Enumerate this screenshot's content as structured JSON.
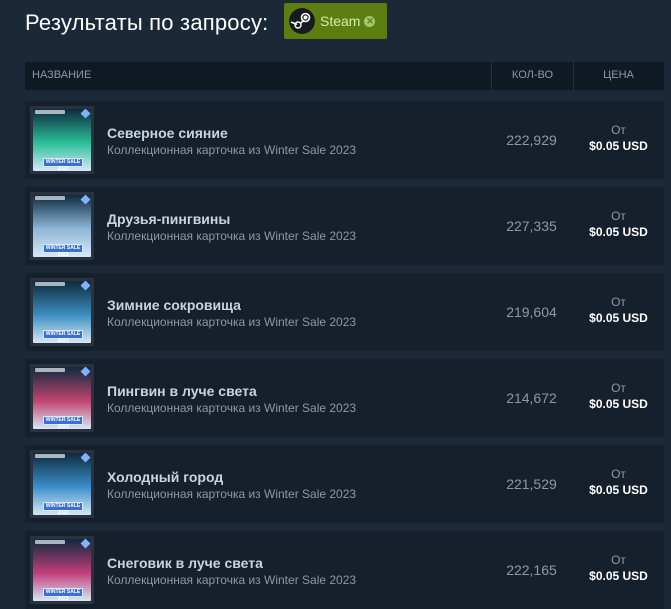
{
  "page": {
    "title": "Результаты по запросу:"
  },
  "filter": {
    "label": "Steam",
    "icon": "steam-logo-icon",
    "remove_icon": "close-icon",
    "color": "#5c7e10"
  },
  "table": {
    "columns": {
      "name": "НАЗВАНИЕ",
      "quantity": "КОЛ-ВО",
      "price": "ЦЕНА"
    },
    "rows": [
      {
        "name": "Северное сияние",
        "subtitle": "Коллекционная карточка из Winter Sale 2023",
        "quantity": "222,929",
        "price_from": "От",
        "price": "$0.05 USD",
        "art_color": "#2bbf9a"
      },
      {
        "name": "Друзья-пингвины",
        "subtitle": "Коллекционная карточка из Winter Sale 2023",
        "quantity": "227,335",
        "price_from": "От",
        "price": "$0.05 USD",
        "art_color": "#8fb7d8"
      },
      {
        "name": "Зимние сокровища",
        "subtitle": "Коллекционная карточка из Winter Sale 2023",
        "quantity": "219,604",
        "price_from": "От",
        "price": "$0.05 USD",
        "art_color": "#3c8fbf"
      },
      {
        "name": "Пингвин в луче света",
        "subtitle": "Коллекционная карточка из Winter Sale 2023",
        "quantity": "214,672",
        "price_from": "От",
        "price": "$0.05 USD",
        "art_color": "#c04470"
      },
      {
        "name": "Холодный город",
        "subtitle": "Коллекционная карточка из Winter Sale 2023",
        "quantity": "221,529",
        "price_from": "От",
        "price": "$0.05 USD",
        "art_color": "#3b8fc9"
      },
      {
        "name": "Снеговик в луче света",
        "subtitle": "Коллекционная карточка из Winter Sale 2023",
        "quantity": "222,165",
        "price_from": "От",
        "price": "$0.05 USD",
        "art_color": "#c23d7c"
      }
    ]
  }
}
